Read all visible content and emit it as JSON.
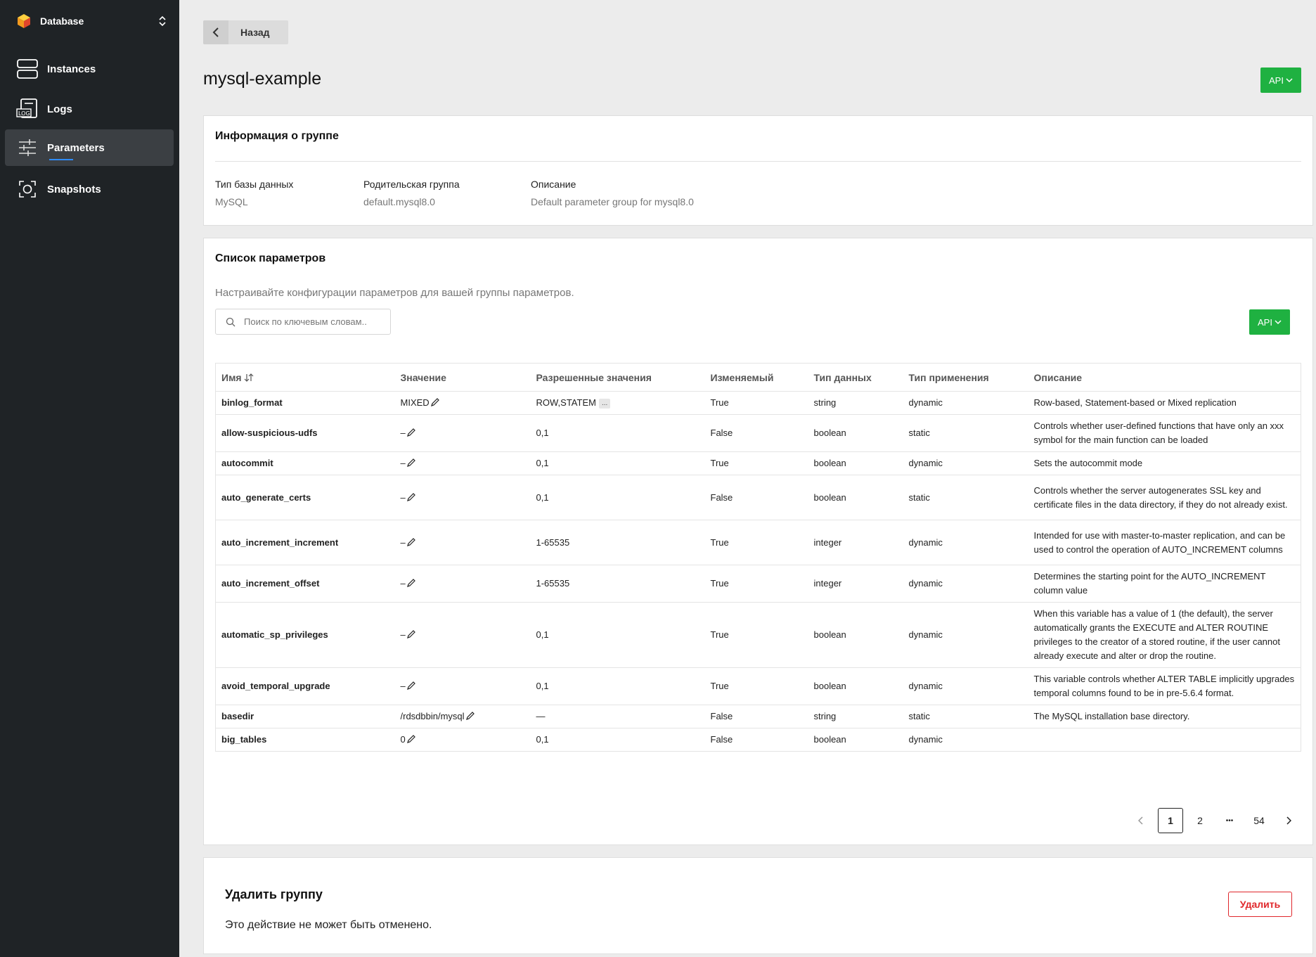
{
  "sidebar": {
    "brand": "Database",
    "items": [
      {
        "label": "Instances",
        "icon": "server-stack-icon"
      },
      {
        "label": "Logs",
        "icon": "log-file-icon"
      },
      {
        "label": "Parameters",
        "icon": "sliders-icon",
        "active": true
      },
      {
        "label": "Snapshots",
        "icon": "snapshot-icon"
      }
    ]
  },
  "header": {
    "back_label": "Назад",
    "title": "mysql-example",
    "api_label": "API"
  },
  "group_info": {
    "title": "Информация о группе",
    "db_type_label": "Тип базы данных",
    "db_type_value": "MySQL",
    "parent_label": "Родительская группа",
    "parent_value": "default.mysql8.0",
    "description_label": "Описание",
    "description_value": "Default parameter group for mysql8.0"
  },
  "params": {
    "title": "Список параметров",
    "subtitle": "Настраивайте конфигурации параметров для вашей группы параметров.",
    "search_placeholder": "Поиск по ключевым словам..",
    "api_label": "API",
    "columns": [
      "Имя",
      "Значение",
      "Разрешенные значения",
      "Изменяемый",
      "Тип данных",
      "Тип применения",
      "Описание"
    ],
    "rows": [
      {
        "name": "binlog_format",
        "value": "MIXED",
        "allowed": "ROW,STATEM",
        "allowed_more": "...",
        "modifiable": "True",
        "dtype": "string",
        "apply": "dynamic",
        "desc": "Row-based, Statement-based or Mixed replication"
      },
      {
        "name": "allow-suspicious-udfs",
        "value": "–",
        "allowed": "0,1",
        "modifiable": "False",
        "dtype": "boolean",
        "apply": "static",
        "desc": "Controls whether user-defined functions that have only an xxx symbol for the main function can be loaded"
      },
      {
        "name": "autocommit",
        "value": "–",
        "allowed": "0,1",
        "modifiable": "True",
        "dtype": "boolean",
        "apply": "dynamic",
        "desc": "Sets the autocommit mode"
      },
      {
        "name": "auto_generate_certs",
        "value": "–",
        "allowed": "0,1",
        "modifiable": "False",
        "dtype": "boolean",
        "apply": "static",
        "desc": "Controls whether the server autogenerates SSL key and certificate files in the data directory, if they do not already exist."
      },
      {
        "name": "auto_increment_increment",
        "value": "–",
        "allowed": "1-65535",
        "modifiable": "True",
        "dtype": "integer",
        "apply": "dynamic",
        "desc": "Intended for use with master-to-master replication, and can be used to control the operation of AUTO_INCREMENT columns"
      },
      {
        "name": "auto_increment_offset",
        "value": "–",
        "allowed": "1-65535",
        "modifiable": "True",
        "dtype": "integer",
        "apply": "dynamic",
        "desc": "Determines the starting point for the AUTO_INCREMENT column value"
      },
      {
        "name": "automatic_sp_privileges",
        "value": "–",
        "allowed": "0,1",
        "modifiable": "True",
        "dtype": "boolean",
        "apply": "dynamic",
        "desc": "When this variable has a value of 1 (the default), the server automatically grants the EXECUTE and ALTER ROUTINE privileges to the creator of a stored routine, if the user cannot already execute and alter or drop the routine."
      },
      {
        "name": "avoid_temporal_upgrade",
        "value": "–",
        "allowed": "0,1",
        "modifiable": "True",
        "dtype": "boolean",
        "apply": "dynamic",
        "desc": "This variable controls whether ALTER TABLE implicitly upgrades temporal columns found to be in pre-5.6.4 format."
      },
      {
        "name": "basedir",
        "value": "/rdsdbbin/mysql",
        "allowed": "—",
        "modifiable": "False",
        "dtype": "string",
        "apply": "static",
        "desc": "The MySQL installation base directory."
      },
      {
        "name": "big_tables",
        "value": "0",
        "allowed": "0,1",
        "modifiable": "False",
        "dtype": "boolean",
        "apply": "dynamic",
        "desc": ""
      }
    ],
    "pagination": {
      "pages": [
        "1",
        "2",
        "•••",
        "54"
      ],
      "current": "1"
    }
  },
  "delete_group": {
    "title": "Удалить группу",
    "description": "Это действие не может быть отменено.",
    "button_label": "Удалить"
  },
  "colors": {
    "sidebar_bg": "#1f2326",
    "accent_green": "#1fb141",
    "danger_red": "#e0272b",
    "active_underline": "#2f8cff"
  }
}
